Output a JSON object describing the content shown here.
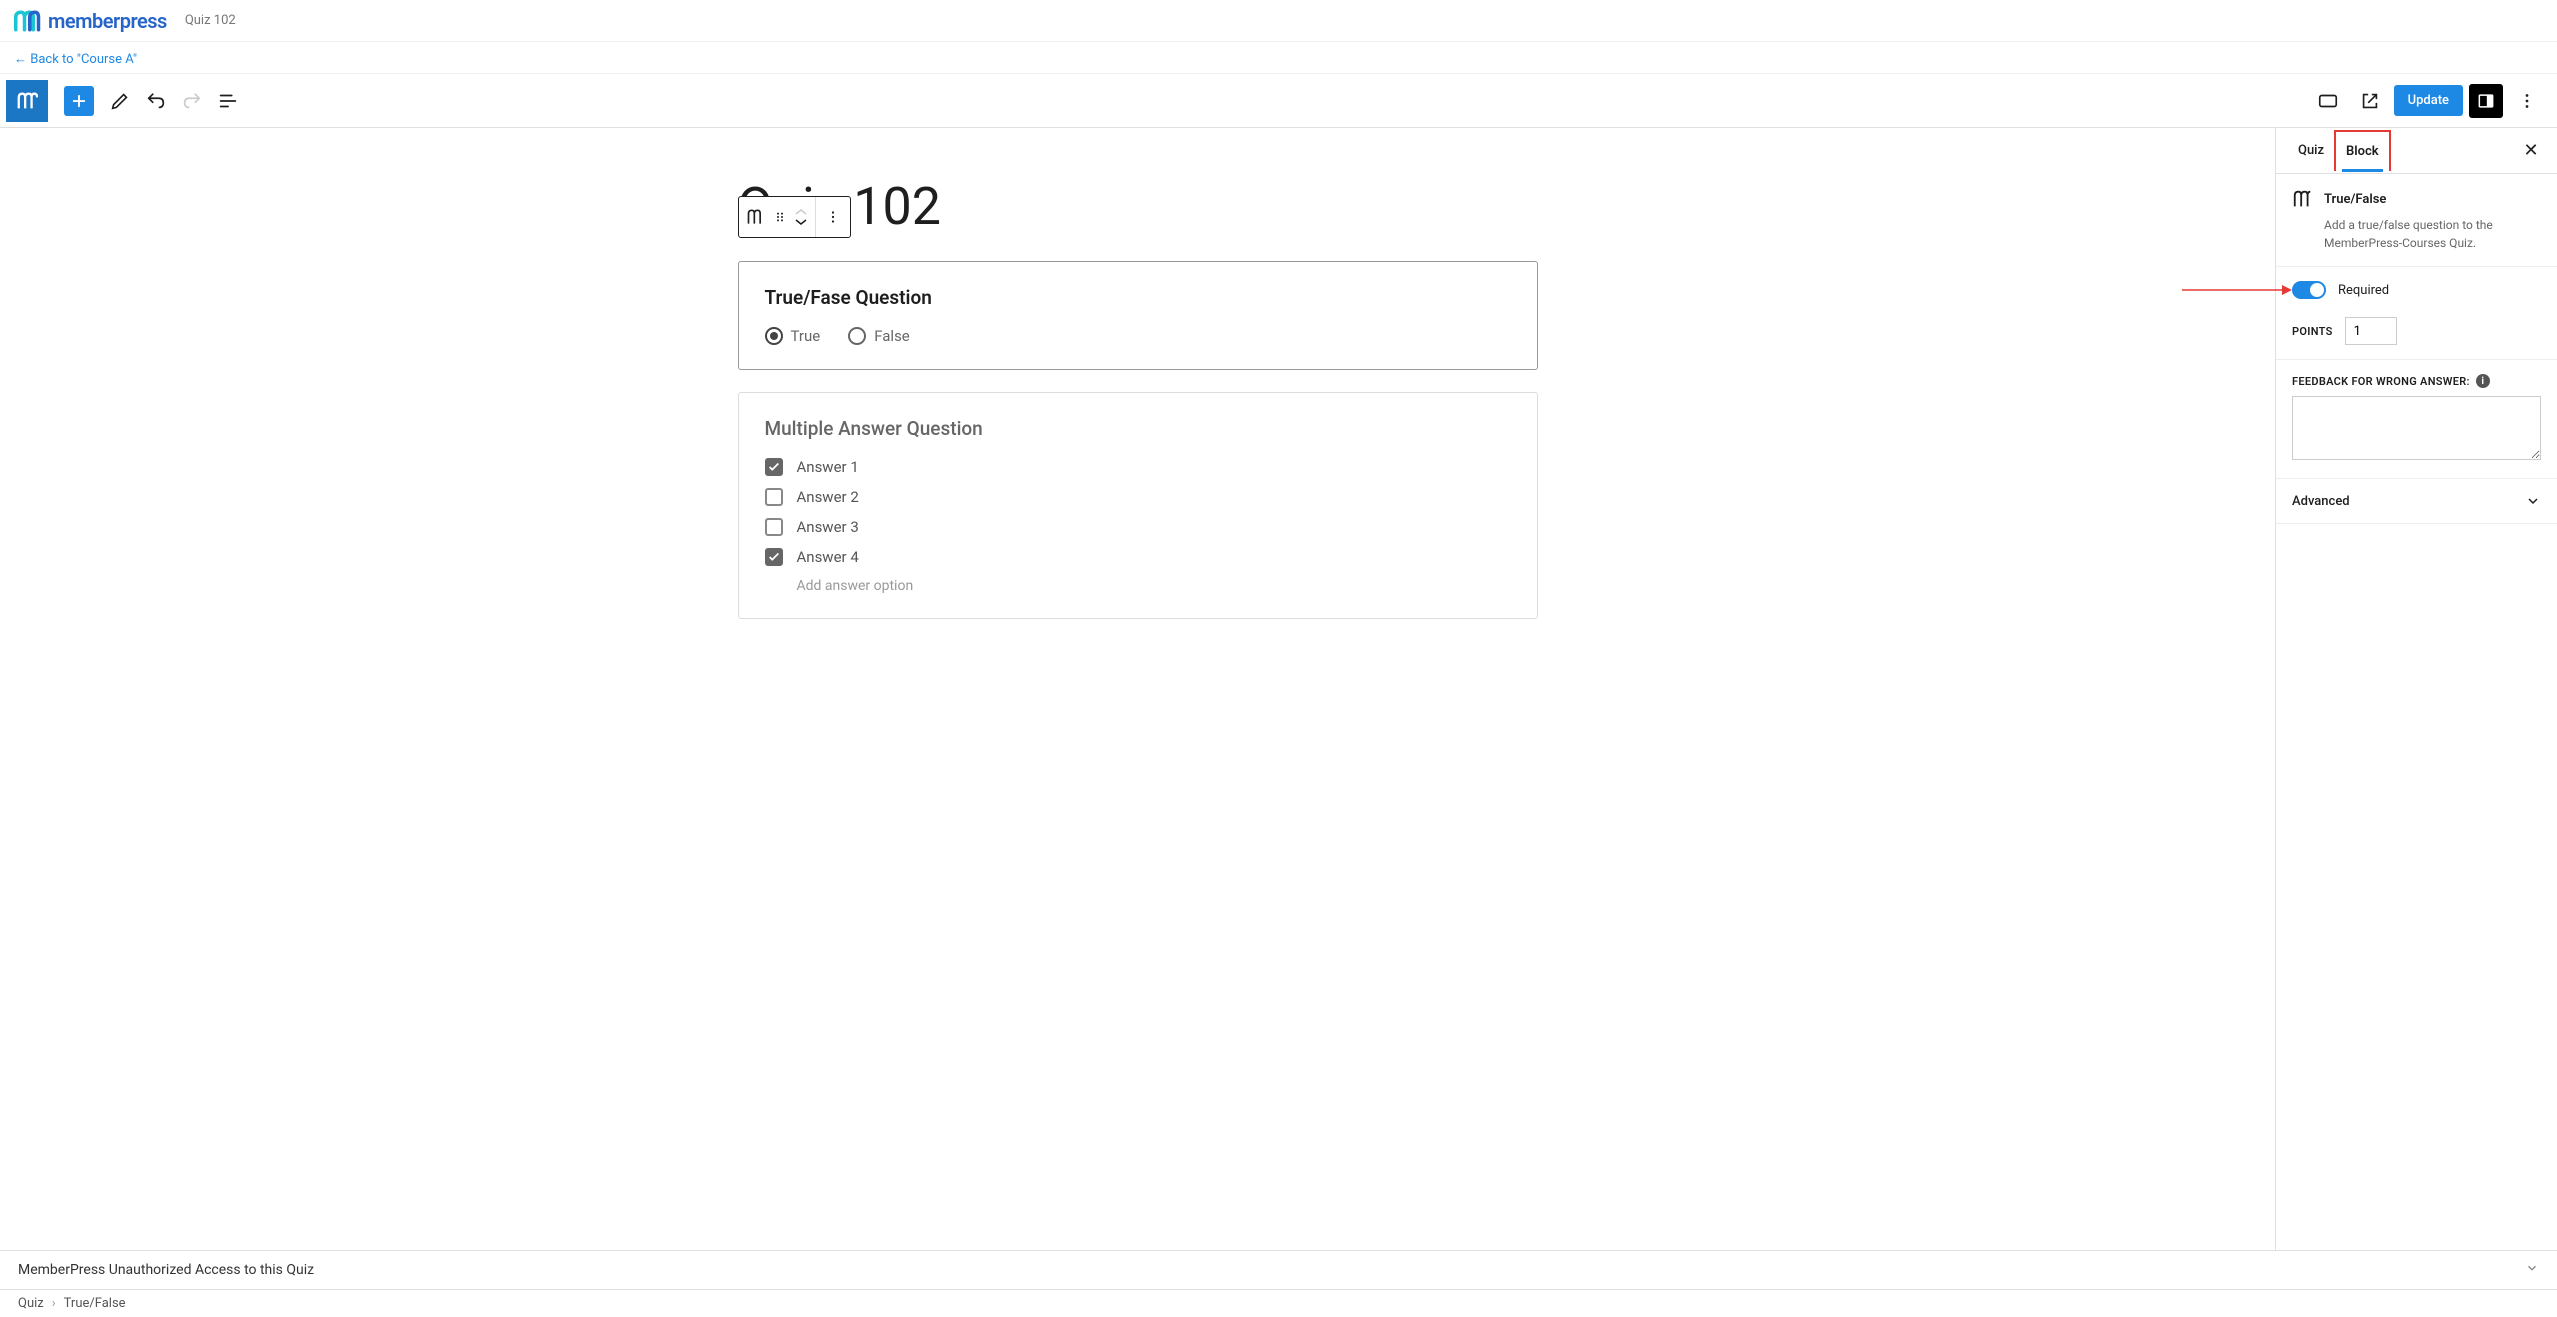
{
  "brand": {
    "name": "memberpress",
    "subtitle": "Quiz 102"
  },
  "back_link": "← Back to \"Course A\"",
  "toolbar": {
    "update_label": "Update"
  },
  "editor": {
    "title": "Quiz 102",
    "block1": {
      "title": "True/Fase Question",
      "option_true": "True",
      "option_false": "False",
      "selected": "true"
    },
    "block2": {
      "title": "Multiple Answer Question",
      "answers": [
        {
          "label": "Answer 1",
          "checked": true
        },
        {
          "label": "Answer 2",
          "checked": false
        },
        {
          "label": "Answer 3",
          "checked": false
        },
        {
          "label": "Answer 4",
          "checked": true
        }
      ],
      "add_label": "Add answer option"
    }
  },
  "sidebar": {
    "tab_quiz": "Quiz",
    "tab_block": "Block",
    "block_type": "True/False",
    "block_desc": "Add a true/false question to the MemberPress-Courses Quiz.",
    "required_label": "Required",
    "required_on": true,
    "points_label": "POINTS",
    "points_value": "1",
    "feedback_label": "FEEDBACK FOR WRONG ANSWER:",
    "feedback_value": "",
    "advanced_label": "Advanced"
  },
  "footer": {
    "message": "MemberPress Unauthorized Access to this Quiz"
  },
  "breadcrumb": {
    "root": "Quiz",
    "current": "True/False"
  }
}
